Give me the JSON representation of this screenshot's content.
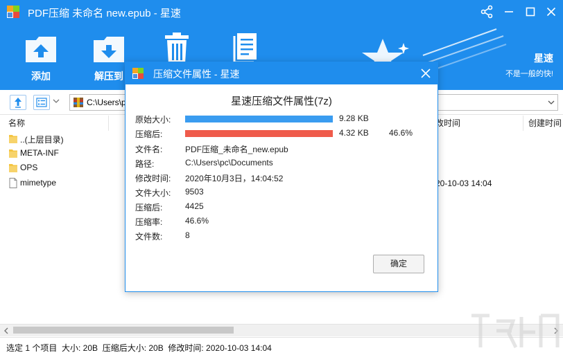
{
  "window": {
    "title": "PDF压缩 未命名 new.epub - 星速",
    "colors": {
      "accent": "#1f8ded",
      "bar_original": "#3a9cf0",
      "bar_compressed": "#ef5b4b",
      "logo": [
        "#f5a623",
        "#7ed321",
        "#4a90e2",
        "#e94b3c"
      ]
    }
  },
  "toolbar": {
    "items": [
      {
        "label": "添加",
        "icon": "add-upload-icon"
      },
      {
        "label": "解压到",
        "icon": "extract-download-icon"
      },
      {
        "label": "",
        "icon": "delete-trash-icon"
      },
      {
        "label": "",
        "icon": "document-info-icon"
      }
    ]
  },
  "brand": {
    "name": "星速",
    "slogan": "不是一般的快!"
  },
  "pathbar": {
    "path": "C:\\Users\\p"
  },
  "list": {
    "columns": [
      "名称",
      "改时间",
      "创建时间"
    ],
    "rows": [
      {
        "name": "..(上层目录)",
        "type": "folder"
      },
      {
        "name": "META-INF",
        "type": "folder"
      },
      {
        "name": "OPS",
        "type": "folder"
      },
      {
        "name": "mimetype",
        "type": "file"
      }
    ],
    "visible_time": "20-10-03 14:04"
  },
  "status": {
    "text": "选定 1 个项目  大小: 20B  压缩后大小: 20B  修改时间: 2020-10-03 14:04"
  },
  "dialog": {
    "title": "压缩文件属性 - 星速",
    "heading": "星速压缩文件属性(7z)",
    "original_size": {
      "label": "原始大小:",
      "value": "9.28 KB",
      "fill": 1.0
    },
    "compressed_size": {
      "label": "压缩后:",
      "value": "4.32 KB",
      "percent": "46.6%",
      "fill": 1.0
    },
    "props": [
      {
        "label": "文件名:",
        "value": "PDF压缩_未命名_new.epub"
      },
      {
        "label": "路径:",
        "value": "C:\\Users\\pc\\Documents"
      },
      {
        "label": "修改时间:",
        "value": "2020年10月3日，14:04:52"
      },
      {
        "label": "文件大小:",
        "value": "9503"
      },
      {
        "label": "压缩后:",
        "value": "4425"
      },
      {
        "label": "压缩率:",
        "value": "46.6%"
      },
      {
        "label": "文件数:",
        "value": "8"
      }
    ],
    "ok_label": "确定"
  }
}
